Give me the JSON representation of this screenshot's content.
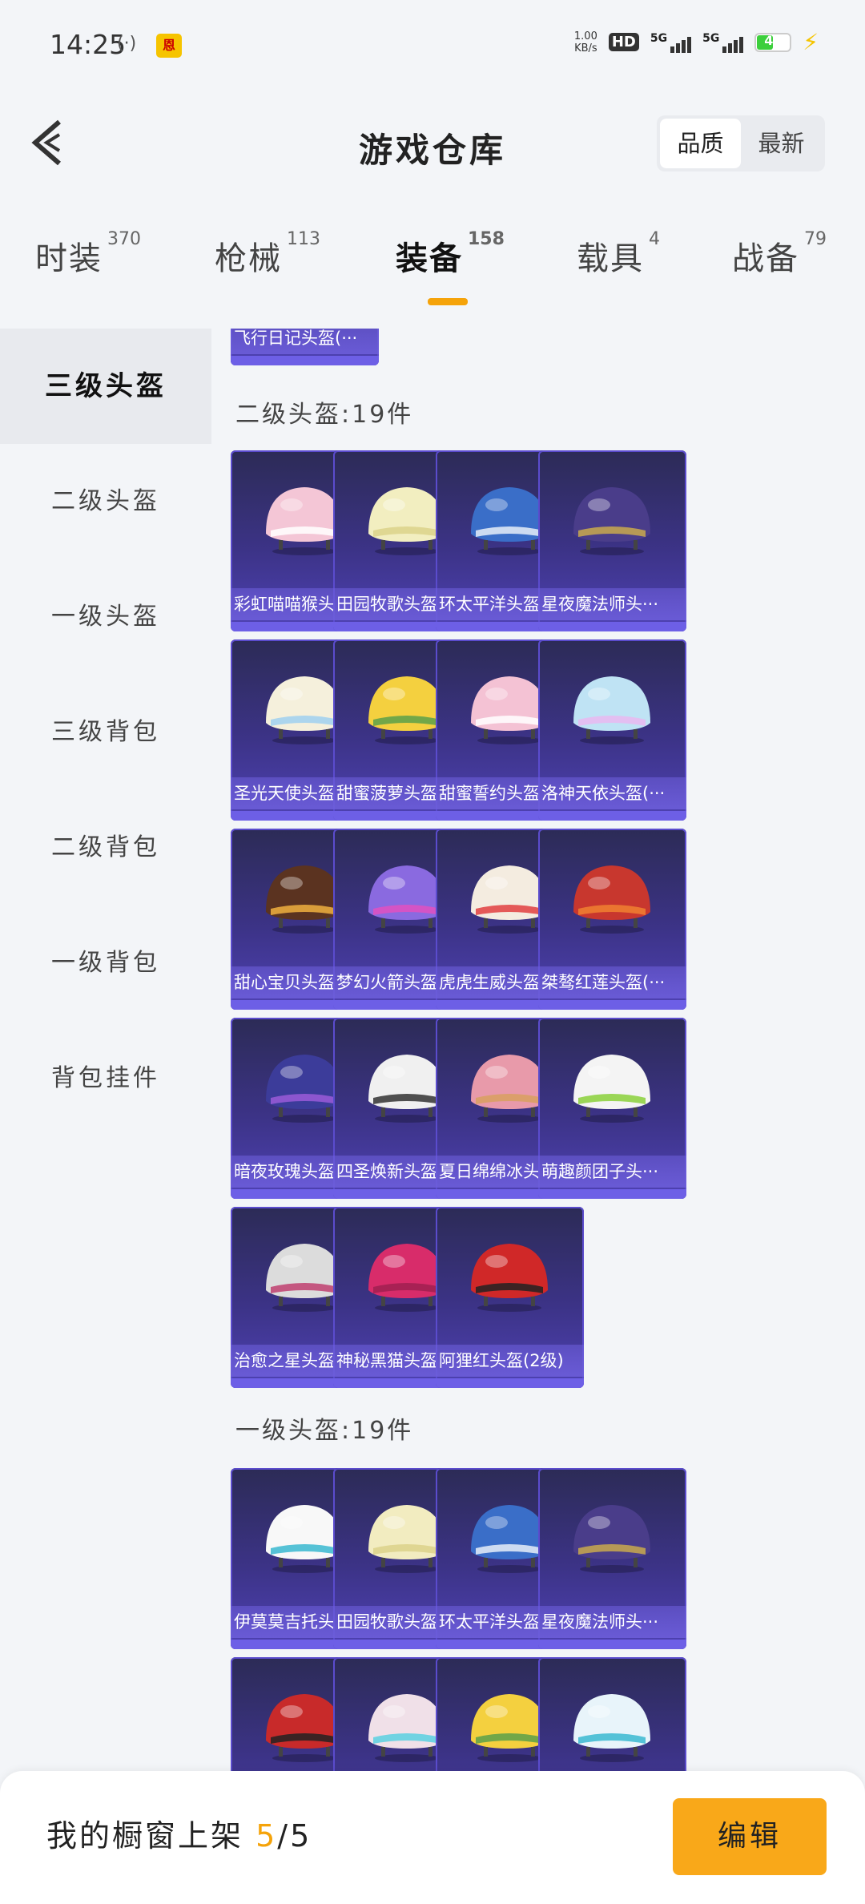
{
  "status_bar": {
    "time": "14:25",
    "nfc": "(·)",
    "app_badge": "恩",
    "speed_value": "1.00",
    "speed_unit": "KB/s",
    "hd": "HD",
    "net1": "5G",
    "net2": "5G",
    "battery": "46"
  },
  "header": {
    "title": "游戏仓库",
    "sort_options": [
      "品质",
      "最新"
    ],
    "sort_selected": "品质"
  },
  "tabs": [
    {
      "label": "时装",
      "count": "370"
    },
    {
      "label": "枪械",
      "count": "113"
    },
    {
      "label": "装备",
      "count": "158"
    },
    {
      "label": "载具",
      "count": "4"
    },
    {
      "label": "战备",
      "count": "79"
    }
  ],
  "active_tab": "装备",
  "sidebar": {
    "items": [
      "三级头盔",
      "二级头盔",
      "一级头盔",
      "三级背包",
      "二级背包",
      "一级背包",
      "背包挂件"
    ],
    "active": "三级头盔"
  },
  "content": {
    "top_partial_item": "飞行日记头盔(···",
    "sections": [
      {
        "title": "二级头盔:19件",
        "items": [
          "彩虹喵喵猴头···",
          "田园牧歌头盔(···",
          "环太平洋头盔(···",
          "星夜魔法师头···",
          "圣光天使头盔(···",
          "甜蜜菠萝头盔(···",
          "甜蜜誓约头盔(···",
          "洛神天依头盔(···",
          "甜心宝贝头盔(···",
          "梦幻火箭头盔(···",
          "虎虎生威头盔(···",
          "桀骜红莲头盔(···",
          "暗夜玫瑰头盔(···",
          "四圣焕新头盔(···",
          "夏日绵绵冰头···",
          "萌趣颜团子头···",
          "治愈之星头盔(···",
          "神秘黑猫头盔(···",
          "阿狸红头盔(2级)"
        ]
      },
      {
        "title": "一级头盔:19件",
        "items": [
          "伊莫莫吉托头···",
          "田园牧歌头盔(···",
          "环太平洋头盔(···",
          "星夜魔法师头···",
          "",
          "",
          "",
          ""
        ]
      }
    ]
  },
  "bottom_bar": {
    "label": "我的橱窗上架",
    "current": "5",
    "separator": "/",
    "total": "5",
    "edit_label": "编辑"
  },
  "colors": {
    "accent": "#f5a30a",
    "edit_button": "#f9a819",
    "card_top": "#2c2b56",
    "card_bottom": "#4f42b4"
  }
}
